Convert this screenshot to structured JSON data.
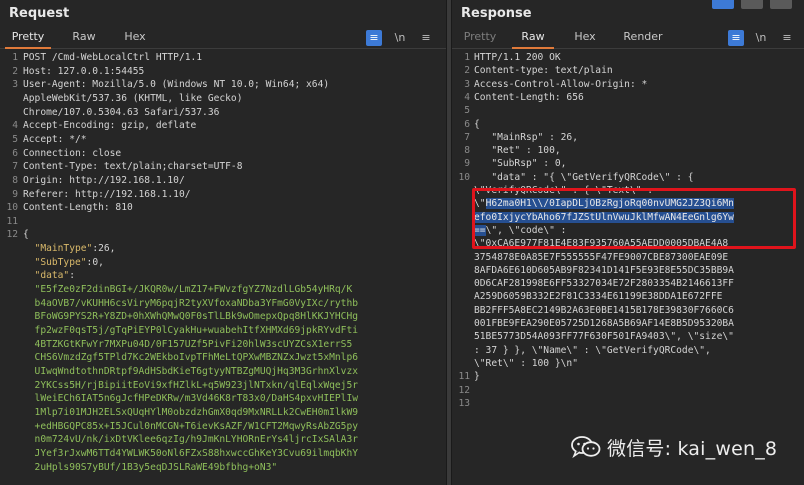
{
  "request": {
    "title": "Request",
    "tabs": [
      "Pretty",
      "Raw",
      "Hex"
    ],
    "active_tab": "Pretty",
    "newline_toggle": "\\n",
    "lines": [
      {
        "n": "1",
        "segments": [
          {
            "t": "POST /Cmd-WebLocalCtrl HTTP/1.1",
            "c": "plain"
          }
        ]
      },
      {
        "n": "2",
        "segments": [
          {
            "t": "Host: 127.0.0.1:54455",
            "c": "plain"
          }
        ]
      },
      {
        "n": "3",
        "segments": [
          {
            "t": "User-Agent: Mozilla/5.0 (Windows NT 10.0; Win64; x64)",
            "c": "plain"
          }
        ]
      },
      {
        "n": "",
        "segments": [
          {
            "t": "AppleWebKit/537.36 (KHTML, like Gecko)",
            "c": "plain"
          }
        ]
      },
      {
        "n": "",
        "segments": [
          {
            "t": "Chrome/107.0.5304.63 Safari/537.36",
            "c": "plain"
          }
        ]
      },
      {
        "n": "4",
        "segments": [
          {
            "t": "Accept-Encoding: gzip, deflate",
            "c": "plain"
          }
        ]
      },
      {
        "n": "5",
        "segments": [
          {
            "t": "Accept: */*",
            "c": "plain"
          }
        ]
      },
      {
        "n": "6",
        "segments": [
          {
            "t": "Connection: close",
            "c": "plain"
          }
        ]
      },
      {
        "n": "7",
        "segments": [
          {
            "t": "Content-Type: text/plain;charset=UTF-8",
            "c": "plain"
          }
        ]
      },
      {
        "n": "8",
        "segments": [
          {
            "t": "Origin: http://192.168.1.10/",
            "c": "plain"
          }
        ]
      },
      {
        "n": "9",
        "segments": [
          {
            "t": "Referer: http://192.168.1.10/",
            "c": "plain"
          }
        ]
      },
      {
        "n": "10",
        "segments": [
          {
            "t": "Content-Length: 810",
            "c": "plain"
          }
        ]
      },
      {
        "n": "11",
        "segments": [
          {
            "t": "",
            "c": "plain"
          }
        ]
      },
      {
        "n": "12",
        "segments": [
          {
            "t": "{",
            "c": "plain"
          }
        ]
      },
      {
        "n": "",
        "segments": [
          {
            "t": "  \"MainType\"",
            "c": "key"
          },
          {
            "t": ":26,",
            "c": "plain"
          }
        ]
      },
      {
        "n": "",
        "segments": [
          {
            "t": "  \"SubType\"",
            "c": "key"
          },
          {
            "t": ":0,",
            "c": "plain"
          }
        ]
      },
      {
        "n": "",
        "segments": [
          {
            "t": "  \"data\"",
            "c": "key"
          },
          {
            "t": ":",
            "c": "plain"
          }
        ]
      },
      {
        "n": "",
        "segments": [
          {
            "t": "  \"E5fZe0zF2dinBGI+/JKQR0w/LmZ17+FWvzfgYZ7NzdlLGb54yHRq/K",
            "c": "str"
          }
        ]
      },
      {
        "n": "",
        "segments": [
          {
            "t": "  b4aOVB7/vKUHH6csViryM6pqjR2tyXVfoxaNDba3YFmG0VyIXc/rythb",
            "c": "str"
          }
        ]
      },
      {
        "n": "",
        "segments": [
          {
            "t": "  BFoWG9PYS2R+Y8ZD+0hXWhQMwQ0F0sTlLBk9wOmepxQpq8HlKKJYHCHg",
            "c": "str"
          }
        ]
      },
      {
        "n": "",
        "segments": [
          {
            "t": "  fp2wzF0qsT5j/gTqPiEYP0lCyakHu+wuabehItfXHMXd69jpkRYvdFti",
            "c": "str"
          }
        ]
      },
      {
        "n": "",
        "segments": [
          {
            "t": "  4BTZKGtKFwYr7MXPu04D/0F157UZf5PivFi20hlW3scUYZCsX1errS5",
            "c": "str"
          }
        ]
      },
      {
        "n": "",
        "segments": [
          {
            "t": "  CHS6VmzdZgf5TPld7Kc2WEkboIvpTFhMeLtQPXwMBZNZxJwzt5xMnlp6",
            "c": "str"
          }
        ]
      },
      {
        "n": "",
        "segments": [
          {
            "t": "  UIwqWndtothnDRtpf9AdHSbdKieT6gtyyNTBZgMUQjHq3M3GrhnXlvzx",
            "c": "str"
          }
        ]
      },
      {
        "n": "",
        "segments": [
          {
            "t": "  2YKCss5H/rjBipiitEoVi9xfHZlkL+q5W923jlNTxkn/qlEqlxWqej5r",
            "c": "str"
          }
        ]
      },
      {
        "n": "",
        "segments": [
          {
            "t": "  lWeiECh6IAT5n6gJcfHPeDKRw/m3Vd46K8rT83x0/DaHS4pxvHIEPlIw",
            "c": "str"
          }
        ]
      },
      {
        "n": "",
        "segments": [
          {
            "t": "  1Mlp7i01MJH2ELSxQUqHYlM0obzdzhGmX0qd9MxNRLLk2CwEH0mIlkW9",
            "c": "str"
          }
        ]
      },
      {
        "n": "",
        "segments": [
          {
            "t": "  +edHBGQPC85x+I5JCul0nMCGN+T6ievKsAZF/W1CFT2MqwyRsAbZG5py",
            "c": "str"
          }
        ]
      },
      {
        "n": "",
        "segments": [
          {
            "t": "  n0m724vU/nk/ixDtVKlee6qzIg/h9JmKnLYHORnErYs4ljrcIxSAlA3r",
            "c": "str"
          }
        ]
      },
      {
        "n": "",
        "segments": [
          {
            "t": "  JYef3rJxwM6TTd4YWLWK50oNl6FZxS88hxwccGhKeY3Cvu69ilmqbKhY",
            "c": "str"
          }
        ]
      },
      {
        "n": "",
        "segments": [
          {
            "t": "  2uHpls90S7yBUf/1B3y5eqDJSLRaWE49bfbhg+oN3\"",
            "c": "str"
          }
        ]
      }
    ]
  },
  "response": {
    "title": "Response",
    "tabs": [
      "Pretty",
      "Raw",
      "Hex",
      "Render"
    ],
    "active_tab": "Raw",
    "newline_toggle": "\\n",
    "lines": [
      {
        "n": "1",
        "segments": [
          {
            "t": "HTTP/1.1 200 OK",
            "c": "plain"
          }
        ]
      },
      {
        "n": "2",
        "segments": [
          {
            "t": "Content-type: text/plain",
            "c": "plain"
          }
        ]
      },
      {
        "n": "3",
        "segments": [
          {
            "t": "Access-Control-Allow-Origin: *",
            "c": "plain"
          }
        ]
      },
      {
        "n": "4",
        "segments": [
          {
            "t": "Content-Length: 656",
            "c": "plain"
          }
        ]
      },
      {
        "n": "5",
        "segments": [
          {
            "t": "",
            "c": "plain"
          }
        ]
      },
      {
        "n": "6",
        "segments": [
          {
            "t": "{",
            "c": "plain"
          }
        ]
      },
      {
        "n": "7",
        "segments": [
          {
            "t": "   \"MainRsp\" : 26,",
            "c": "plain"
          }
        ]
      },
      {
        "n": "8",
        "segments": [
          {
            "t": "   \"Ret\" : 100,",
            "c": "plain"
          }
        ]
      },
      {
        "n": "9",
        "segments": [
          {
            "t": "   \"SubRsp\" : 0,",
            "c": "plain"
          }
        ]
      },
      {
        "n": "10",
        "segments": [
          {
            "t": "   \"data\" : \"{ \\\"GetVerifyQRCode\\\" : {",
            "c": "plain"
          }
        ]
      },
      {
        "n": "",
        "segments": [
          {
            "t": "\\\"VerifyQRCode\\\" : { \\\"Text\\\" :",
            "c": "plain"
          }
        ]
      },
      {
        "n": "",
        "segments": [
          {
            "t": "\\\"",
            "c": "plain"
          },
          {
            "t": "H62ma0H1\\\\/0IapDLjOBzRgjoRq00nvUMG2JZ3Qi6Mn",
            "c": "sel"
          }
        ]
      },
      {
        "n": "",
        "segments": [
          {
            "t": "efo0IxjycYbAho67fJZStUlnVwuJklMfwAN4EeGnlg6Yw",
            "c": "sel"
          }
        ]
      },
      {
        "n": "",
        "segments": [
          {
            "t": "==",
            "c": "sel"
          },
          {
            "t": "\\\", \\\"code\\\" :",
            "c": "plain"
          }
        ]
      },
      {
        "n": "",
        "segments": [
          {
            "t": "\\\"0xCA6E977F81E4E83F935760A55AEDD0005DBAE4A8",
            "c": "plain"
          }
        ]
      },
      {
        "n": "",
        "segments": [
          {
            "t": "3754878E0A85E7F555555F47FE9007CBE87300EAE09E",
            "c": "plain"
          }
        ]
      },
      {
        "n": "",
        "segments": [
          {
            "t": "8AFDA6E610D605AB9F82341D141F5E93E8E55DC35BB9A",
            "c": "plain"
          }
        ]
      },
      {
        "n": "",
        "segments": [
          {
            "t": "0D6CAF281998E6FF53327034E72F2803354B2146613FF",
            "c": "plain"
          }
        ]
      },
      {
        "n": "",
        "segments": [
          {
            "t": "A259D6059B332E2F81C3334E61199E38DDA1E672FFE",
            "c": "plain"
          }
        ]
      },
      {
        "n": "",
        "segments": [
          {
            "t": "BB2FFF5A8EC2149B2A63E0BE1415B178E39830F7660C6",
            "c": "plain"
          }
        ]
      },
      {
        "n": "",
        "segments": [
          {
            "t": "001FBE9FEA290E05725D1268A5B69AF14E8B5D95320BA",
            "c": "plain"
          }
        ]
      },
      {
        "n": "",
        "segments": [
          {
            "t": "51BE5773D54A093FF77F630F501FA9403\\\", \\\"size\\\"",
            "c": "plain"
          }
        ]
      },
      {
        "n": "",
        "segments": [
          {
            "t": ": 37 } }, \\\"Name\\\" : \\\"GetVerifyQRCode\\\",",
            "c": "plain"
          }
        ]
      },
      {
        "n": "",
        "segments": [
          {
            "t": "\\\"Ret\\\" : 100 }\\n\"",
            "c": "plain"
          }
        ]
      },
      {
        "n": "11",
        "segments": [
          {
            "t": "}",
            "c": "plain"
          }
        ]
      },
      {
        "n": "12",
        "segments": [
          {
            "t": "",
            "c": "plain"
          }
        ]
      },
      {
        "n": "13",
        "segments": [
          {
            "t": "",
            "c": "plain"
          }
        ]
      }
    ]
  },
  "watermark": {
    "text": "微信号: kai_wen_8",
    "icon": "wechat-icon"
  },
  "colors": {
    "highlight_box": "#e0141c",
    "active_tab_underline": "#e07a3a",
    "selection": "#264f91",
    "json_key": "#d9b96a",
    "json_string": "#8fbf5b"
  }
}
